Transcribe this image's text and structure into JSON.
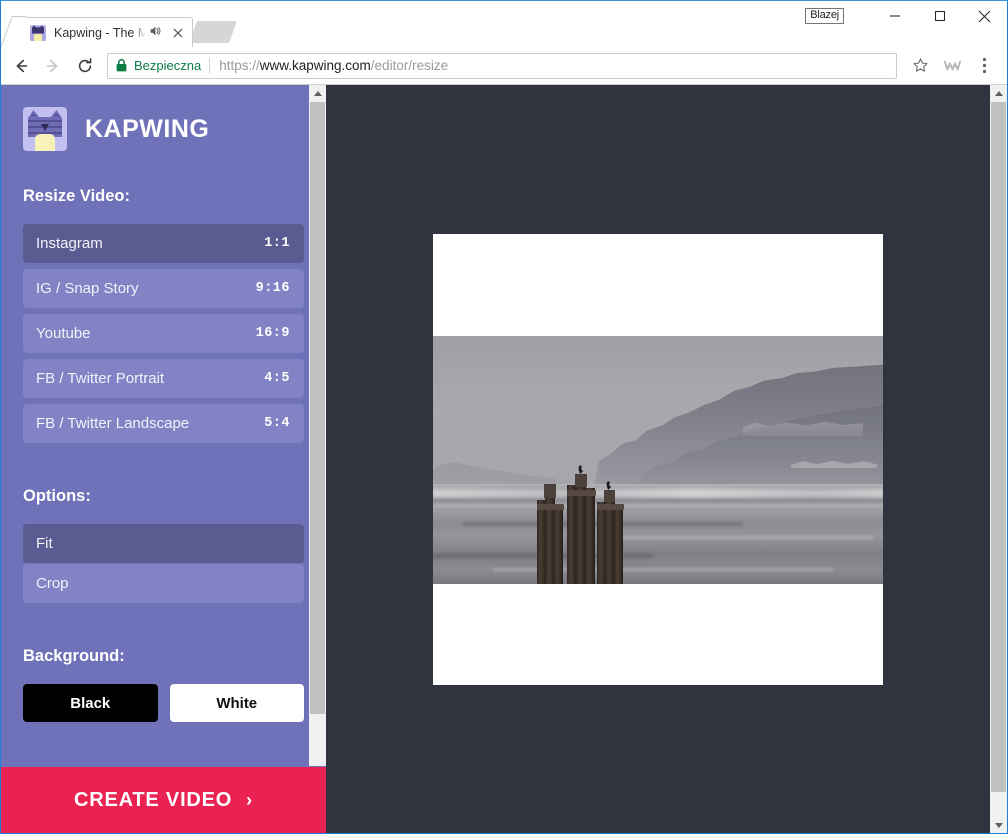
{
  "window": {
    "profile_name": "Blazej",
    "minimize_label": "Minimize",
    "maximize_label": "Maximize",
    "close_label": "Close"
  },
  "tab": {
    "title": "Kapwing - The Moder",
    "favicon_name": "kapwing-cat-favicon",
    "audio_icon": "speaker-icon",
    "close_icon": "close-icon"
  },
  "toolbar": {
    "back_icon": "back-arrow-icon",
    "forward_icon": "forward-arrow-icon",
    "reload_icon": "reload-icon",
    "security_label": "Bezpieczna",
    "lock_icon": "lock-icon",
    "url_scheme": "https://",
    "url_host": "www.kapwing.com",
    "url_path": "/editor/resize",
    "bookmark_icon": "star-icon",
    "extension_icon": "extension-icon",
    "menu_icon": "three-dot-menu-icon"
  },
  "sidebar": {
    "brand": {
      "name": "KAPWING",
      "logo_icon": "kapwing-cat-logo"
    },
    "resize": {
      "label": "Resize Video:",
      "items": [
        {
          "label": "Instagram",
          "ratio": "1:1",
          "selected": true
        },
        {
          "label": "IG / Snap Story",
          "ratio": "9:16",
          "selected": false
        },
        {
          "label": "Youtube",
          "ratio": "16:9",
          "selected": false
        },
        {
          "label": "FB / Twitter Portrait",
          "ratio": "4:5",
          "selected": false
        },
        {
          "label": "FB / Twitter Landscape",
          "ratio": "5:4",
          "selected": false
        }
      ]
    },
    "options": {
      "label": "Options:",
      "items": [
        {
          "label": "Fit",
          "selected": true
        },
        {
          "label": "Crop",
          "selected": false
        }
      ]
    },
    "background": {
      "label": "Background:",
      "items": [
        {
          "label": "Black",
          "color": "#000000",
          "selected": false
        },
        {
          "label": "White",
          "color": "#ffffff",
          "selected": false
        }
      ]
    },
    "cta": {
      "label": "CREATE VIDEO",
      "chevron": "›"
    },
    "colors": {
      "panel": "#6f72b8",
      "item": "#8183c4",
      "item_selected": "#5a5b90",
      "cta": "#ea2252"
    }
  },
  "canvas": {
    "background_color": "#30343f",
    "frame_background": "#ffffff",
    "media_description": "Misty coastal scene with wooden pilings and perched birds"
  },
  "scrollbars": {
    "up_arrow": "scroll-up-arrow",
    "down_arrow": "scroll-down-arrow"
  }
}
